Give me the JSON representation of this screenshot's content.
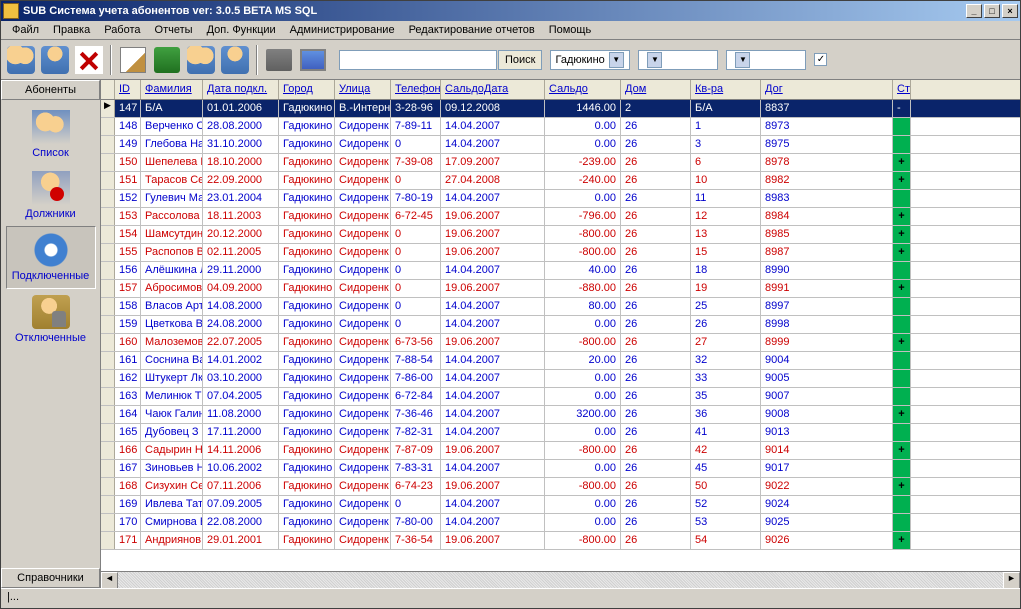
{
  "window": {
    "title": "SUB Система учета абонентов ver: 3.0.5 BETA MS SQL"
  },
  "menu": [
    "Файл",
    "Правка",
    "Работа",
    "Отчеты",
    "Доп. Функции",
    "Администрирование",
    "Редактирование отчетов",
    "Помощь"
  ],
  "toolbar": {
    "search_btn": "Поиск",
    "combo1": "Гадюкино",
    "combo2": "",
    "combo3": "",
    "check": "✓"
  },
  "sidebar": {
    "tabs": {
      "top": "Абоненты",
      "bottom": "Справочники"
    },
    "items": [
      {
        "label": "Список",
        "icon": "list"
      },
      {
        "label": "Должники",
        "icon": "debt"
      },
      {
        "label": "Подключенные",
        "icon": "conn",
        "selected": true
      },
      {
        "label": "Отключенные",
        "icon": "disc"
      }
    ]
  },
  "grid": {
    "headers": [
      "ID",
      "Фамилия",
      "Дата подкл.",
      "Город",
      "Улица",
      "Телефон",
      "СальдоДата",
      "Сальдо",
      "Дом",
      "Кв-ра",
      "Дог",
      "Ст"
    ],
    "rows": [
      {
        "sel": true,
        "id": "147",
        "fam": "Б/А",
        "date": "01.01.2006",
        "city": "Гадюкино",
        "street": "В.-Интерн",
        "phone": "3-28-96",
        "sdate": "09.12.2008",
        "saldo": "1446.00",
        "dom": "2",
        "kv": "Б/А",
        "dog": "8837",
        "st": "-"
      },
      {
        "id": "148",
        "fam": "Верченко С",
        "date": "28.08.2000",
        "city": "Гадюкино",
        "street": "Сидоренк",
        "phone": "7-89-11",
        "sdate": "14.04.2007",
        "saldo": "0.00",
        "dom": "26",
        "kv": "1",
        "dog": "8973",
        "st": ""
      },
      {
        "id": "149",
        "fam": "Глебова На",
        "date": "31.10.2000",
        "city": "Гадюкино",
        "street": "Сидоренк",
        "phone": "0",
        "sdate": "14.04.2007",
        "saldo": "0.00",
        "dom": "26",
        "kv": "3",
        "dog": "8975",
        "st": ""
      },
      {
        "neg": true,
        "id": "150",
        "fam": "Шепелева В",
        "date": "18.10.2000",
        "city": "Гадюкино",
        "street": "Сидоренк",
        "phone": "7-39-08",
        "sdate": "17.09.2007",
        "saldo": "-239.00",
        "dom": "26",
        "kv": "6",
        "dog": "8978",
        "st": "+"
      },
      {
        "neg": true,
        "id": "151",
        "fam": "Тарасов Се",
        "date": "22.09.2000",
        "city": "Гадюкино",
        "street": "Сидоренк",
        "phone": "0",
        "sdate": "27.04.2008",
        "saldo": "-240.00",
        "dom": "26",
        "kv": "10",
        "dog": "8982",
        "st": "+"
      },
      {
        "id": "152",
        "fam": "Гулевич Ма",
        "date": "23.01.2004",
        "city": "Гадюкино",
        "street": "Сидоренк",
        "phone": "7-80-19",
        "sdate": "14.04.2007",
        "saldo": "0.00",
        "dom": "26",
        "kv": "11",
        "dog": "8983",
        "st": ""
      },
      {
        "neg": true,
        "id": "153",
        "fam": "Рассолова",
        "date": "18.11.2003",
        "city": "Гадюкино",
        "street": "Сидоренк",
        "phone": "6-72-45",
        "sdate": "19.06.2007",
        "saldo": "-796.00",
        "dom": "26",
        "kv": "12",
        "dog": "8984",
        "st": "+"
      },
      {
        "neg": true,
        "id": "154",
        "fam": "Шамсутдин",
        "date": "20.12.2000",
        "city": "Гадюкино",
        "street": "Сидоренк",
        "phone": "0",
        "sdate": "19.06.2007",
        "saldo": "-800.00",
        "dom": "26",
        "kv": "13",
        "dog": "8985",
        "st": "+"
      },
      {
        "neg": true,
        "id": "155",
        "fam": "Распопов В",
        "date": "02.11.2005",
        "city": "Гадюкино",
        "street": "Сидоренк",
        "phone": "0",
        "sdate": "19.06.2007",
        "saldo": "-800.00",
        "dom": "26",
        "kv": "15",
        "dog": "8987",
        "st": "+"
      },
      {
        "id": "156",
        "fam": "Алёшкина Л",
        "date": "29.11.2000",
        "city": "Гадюкино",
        "street": "Сидоренк",
        "phone": "0",
        "sdate": "14.04.2007",
        "saldo": "40.00",
        "dom": "26",
        "kv": "18",
        "dog": "8990",
        "st": ""
      },
      {
        "neg": true,
        "id": "157",
        "fam": "Абросимов",
        "date": "04.09.2000",
        "city": "Гадюкино",
        "street": "Сидоренк",
        "phone": "0",
        "sdate": "19.06.2007",
        "saldo": "-880.00",
        "dom": "26",
        "kv": "19",
        "dog": "8991",
        "st": "+"
      },
      {
        "id": "158",
        "fam": "Власов Арт",
        "date": "14.08.2000",
        "city": "Гадюкино",
        "street": "Сидоренк",
        "phone": "0",
        "sdate": "14.04.2007",
        "saldo": "80.00",
        "dom": "26",
        "kv": "25",
        "dog": "8997",
        "st": ""
      },
      {
        "id": "159",
        "fam": "Цветкова В",
        "date": "24.08.2000",
        "city": "Гадюкино",
        "street": "Сидоренк",
        "phone": "0",
        "sdate": "14.04.2007",
        "saldo": "0.00",
        "dom": "26",
        "kv": "26",
        "dog": "8998",
        "st": ""
      },
      {
        "neg": true,
        "id": "160",
        "fam": "Малоземов",
        "date": "22.07.2005",
        "city": "Гадюкино",
        "street": "Сидоренк",
        "phone": "6-73-56",
        "sdate": "19.06.2007",
        "saldo": "-800.00",
        "dom": "26",
        "kv": "27",
        "dog": "8999",
        "st": "+"
      },
      {
        "id": "161",
        "fam": "Соснина Ва",
        "date": "14.01.2002",
        "city": "Гадюкино",
        "street": "Сидоренк",
        "phone": "7-88-54",
        "sdate": "14.04.2007",
        "saldo": "20.00",
        "dom": "26",
        "kv": "32",
        "dog": "9004",
        "st": ""
      },
      {
        "id": "162",
        "fam": "Штукерт Лк",
        "date": "03.10.2000",
        "city": "Гадюкино",
        "street": "Сидоренк",
        "phone": "7-86-00",
        "sdate": "14.04.2007",
        "saldo": "0.00",
        "dom": "26",
        "kv": "33",
        "dog": "9005",
        "st": ""
      },
      {
        "id": "163",
        "fam": "Мелинюк Т",
        "date": "07.04.2005",
        "city": "Гадюкино",
        "street": "Сидоренк",
        "phone": "6-72-84",
        "sdate": "14.04.2007",
        "saldo": "0.00",
        "dom": "26",
        "kv": "35",
        "dog": "9007",
        "st": ""
      },
      {
        "id": "164",
        "fam": "Чаюк Галин",
        "date": "11.08.2000",
        "city": "Гадюкино",
        "street": "Сидоренк",
        "phone": "7-36-46",
        "sdate": "14.04.2007",
        "saldo": "3200.00",
        "dom": "26",
        "kv": "36",
        "dog": "9008",
        "st": "+"
      },
      {
        "id": "165",
        "fam": "Дубовец З",
        "date": "17.11.2000",
        "city": "Гадюкино",
        "street": "Сидоренк",
        "phone": "7-82-31",
        "sdate": "14.04.2007",
        "saldo": "0.00",
        "dom": "26",
        "kv": "41",
        "dog": "9013",
        "st": ""
      },
      {
        "neg": true,
        "id": "166",
        "fam": "Садырин Ни",
        "date": "14.11.2006",
        "city": "Гадюкино",
        "street": "Сидоренк",
        "phone": "7-87-09",
        "sdate": "19.06.2007",
        "saldo": "-800.00",
        "dom": "26",
        "kv": "42",
        "dog": "9014",
        "st": "+"
      },
      {
        "id": "167",
        "fam": "Зиновьев Н",
        "date": "10.06.2002",
        "city": "Гадюкино",
        "street": "Сидоренк",
        "phone": "7-83-31",
        "sdate": "14.04.2007",
        "saldo": "0.00",
        "dom": "26",
        "kv": "45",
        "dog": "9017",
        "st": ""
      },
      {
        "neg": true,
        "id": "168",
        "fam": "Сизухин  Се",
        "date": "07.11.2006",
        "city": "Гадюкино",
        "street": "Сидоренк",
        "phone": "6-74-23",
        "sdate": "19.06.2007",
        "saldo": "-800.00",
        "dom": "26",
        "kv": "50",
        "dog": "9022",
        "st": "+"
      },
      {
        "id": "169",
        "fam": "Ивлева Тат",
        "date": "07.09.2005",
        "city": "Гадюкино",
        "street": "Сидоренк",
        "phone": "0",
        "sdate": "14.04.2007",
        "saldo": "0.00",
        "dom": "26",
        "kv": "52",
        "dog": "9024",
        "st": ""
      },
      {
        "id": "170",
        "fam": "Смирнова В",
        "date": "22.08.2000",
        "city": "Гадюкино",
        "street": "Сидоренк",
        "phone": "7-80-00",
        "sdate": "14.04.2007",
        "saldo": "0.00",
        "dom": "26",
        "kv": "53",
        "dog": "9025",
        "st": ""
      },
      {
        "neg": true,
        "id": "171",
        "fam": "Андриянов",
        "date": "29.01.2001",
        "city": "Гадюкино",
        "street": "Сидоренк",
        "phone": "7-36-54",
        "sdate": "19.06.2007",
        "saldo": "-800.00",
        "dom": "26",
        "kv": "54",
        "dog": "9026",
        "st": "+"
      }
    ]
  },
  "status": "|..."
}
